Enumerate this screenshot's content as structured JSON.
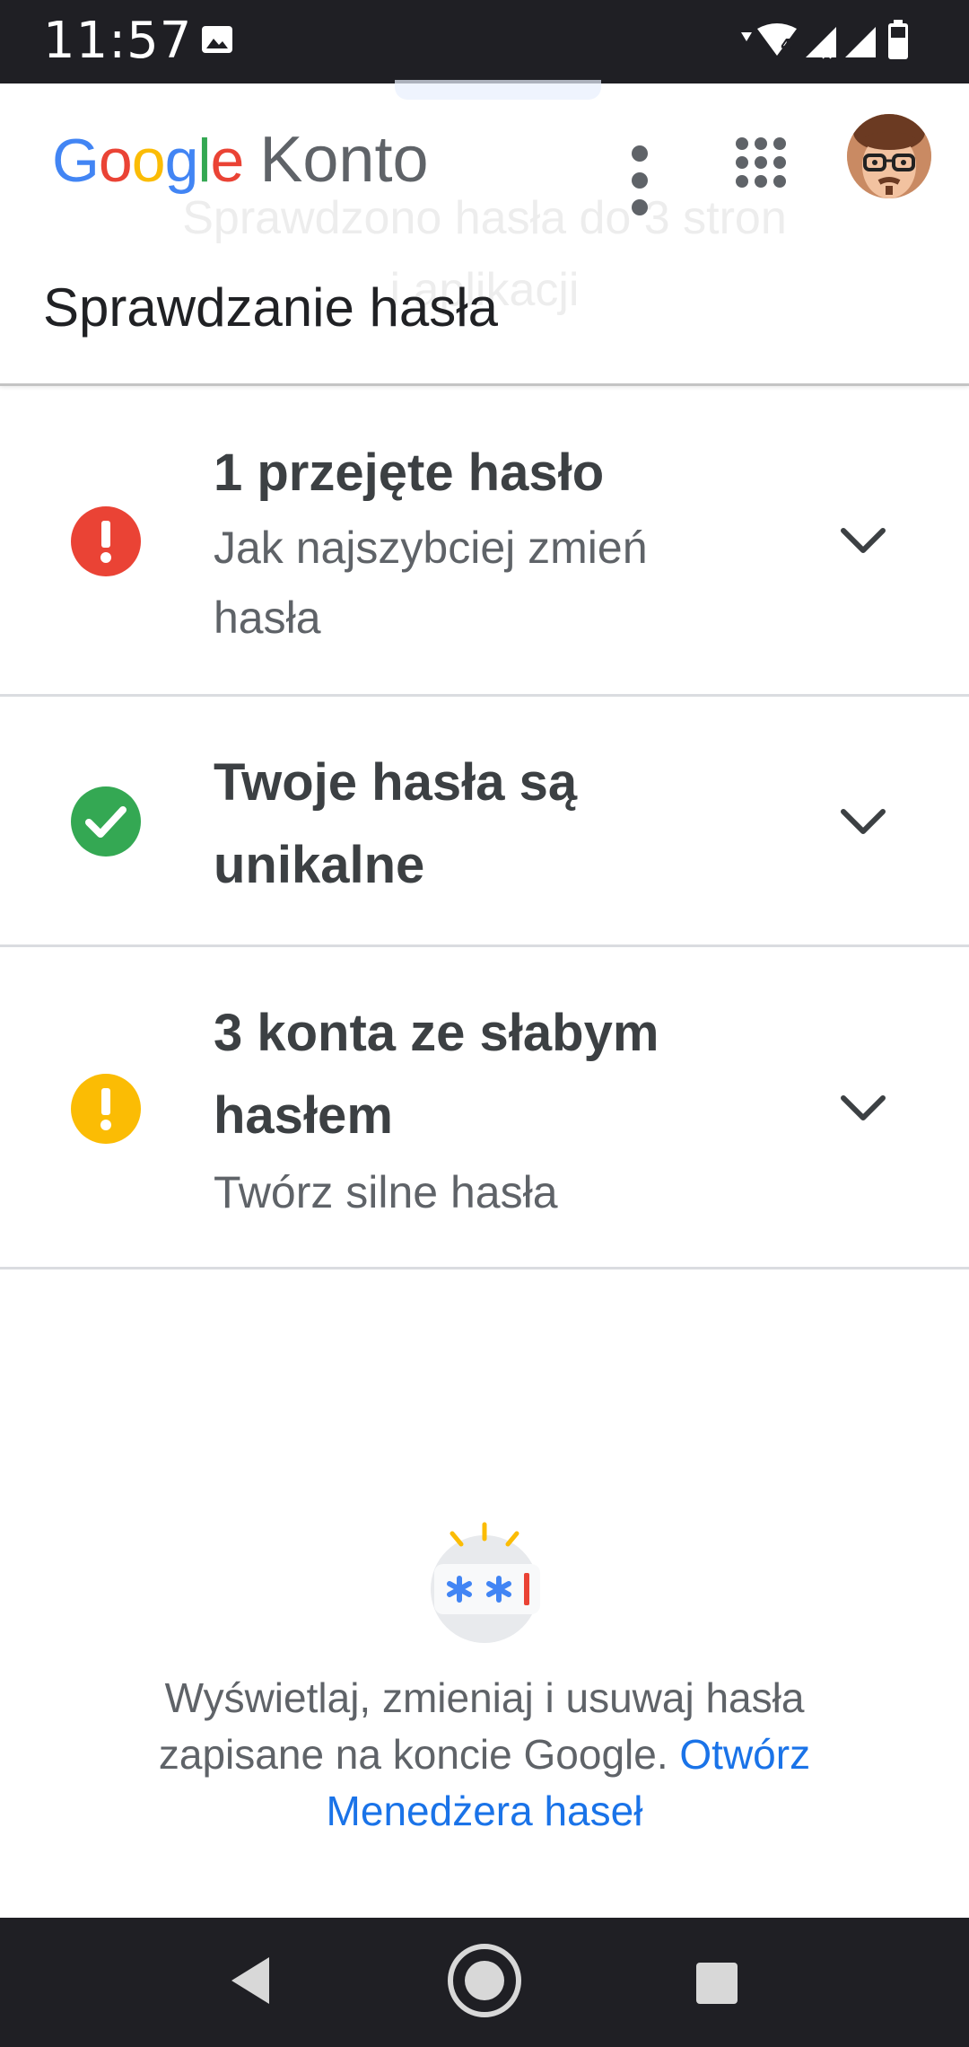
{
  "status_bar": {
    "time": "11:57",
    "icons": [
      "image-icon",
      "wifi-icon",
      "signal-icon",
      "signal-icon",
      "battery-icon"
    ],
    "network_badge": "4"
  },
  "header": {
    "logo_text": "Google",
    "product": "Konto",
    "title": "Sprawdzanie hasła",
    "background_text_line1": "Sprawdzono hasła do 3 stron",
    "background_text_line2": "i aplikacji"
  },
  "items": [
    {
      "title": "1 przejęte hasło",
      "subtitle_line1": "Jak najszybciej zmień",
      "subtitle_line2": "hasła",
      "icon": "error-icon",
      "color": "#ea4335"
    },
    {
      "title_line1": "Twoje hasła są",
      "title_line2": "unikalne",
      "icon": "check-icon",
      "color": "#34a853"
    },
    {
      "title_line1": "3 konta ze słabym",
      "title_line2": "hasłem",
      "subtitle": "Twórz silne hasła",
      "icon": "warning-icon",
      "color": "#fbbc04"
    }
  ],
  "info": {
    "line1": "Wyświetlaj, zmieniaj i usuwaj hasła",
    "line2_text": "zapisane na koncie Google.",
    "link_part1": "Otwórz",
    "link_part2": "Menedżera haseł"
  },
  "colors": {
    "accent": "#1a73e8",
    "google_blue": "#4285f4",
    "google_red": "#ea4335",
    "google_yellow": "#fbbc05",
    "google_green": "#34a853"
  }
}
